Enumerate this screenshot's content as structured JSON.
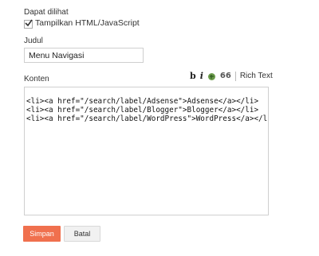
{
  "visibility": {
    "label": "Dapat dilihat",
    "checkbox_label": "Tampilkan HTML/JavaScript",
    "checked": true
  },
  "title": {
    "label": "Judul",
    "value": "Menu Navigasi"
  },
  "content": {
    "label": "Konten",
    "toolbar": {
      "bold": "b",
      "italic": "i",
      "link_icon": "link-icon",
      "quote": "66",
      "rich_text": "Rich Text"
    },
    "lines": [
      "<li><a href=\"/search/label/Adsense\">Adsense</a></li>",
      "<li><a href=\"/search/label/Blogger\">Blogger</a></li>",
      "<li><a href=\"/search/label/WordPress\">WordPress</a></li>"
    ]
  },
  "buttons": {
    "save": "Simpan",
    "cancel": "Batal"
  },
  "colors": {
    "save_button": "#f0704e",
    "border": "#cfcfcf"
  }
}
